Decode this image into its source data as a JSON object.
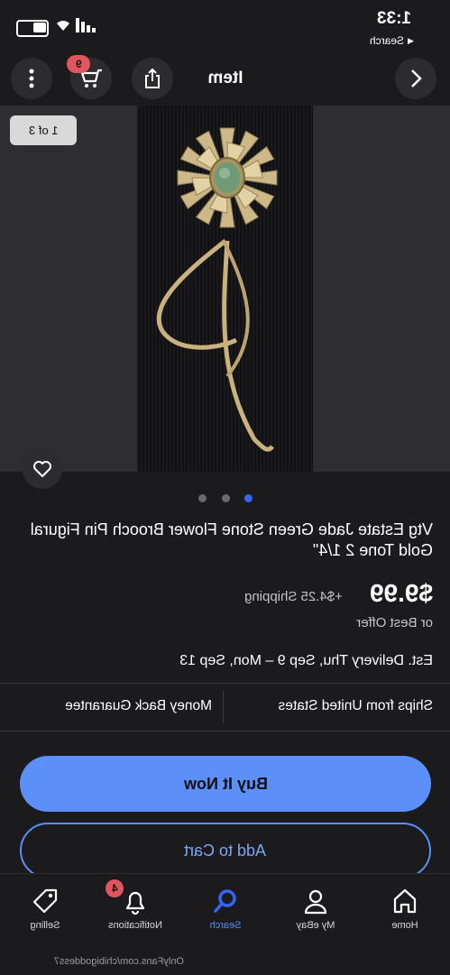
{
  "status": {
    "time": "1:33",
    "back_app": "Search"
  },
  "header": {
    "title": "Item",
    "cart_count": "9"
  },
  "gallery": {
    "counter": "1 of 3",
    "dots_total": 3,
    "dots_active": 1
  },
  "listing": {
    "title": "Vtg Estate Jade Green Stone Flower Brooch Pin Figural Gold Tone 2 1/4\"",
    "price": "$9.99",
    "shipping": "+$4.25 Shipping",
    "best_offer": "or Best Offer",
    "delivery": "Est. Delivery Thu, Sep 9 – Mon, Sep 13",
    "ships_from": "Ships from United States",
    "guarantee": "Money Back Guarantee"
  },
  "actions": {
    "buy_now": "Buy It Now",
    "add_to_cart": "Add to Cart"
  },
  "bottom_nav": {
    "home": "Home",
    "my_ebay": "My eBay",
    "search": "Search",
    "notifications": "Notifications",
    "notifications_count": "4",
    "selling": "Selling"
  },
  "watermark": "OnlyFans.com/chibigoddess7",
  "colors": {
    "accent": "#3665f3",
    "buy_button": "#5c8ff7",
    "badge": "#e0565e",
    "background": "#1b1b1d"
  }
}
